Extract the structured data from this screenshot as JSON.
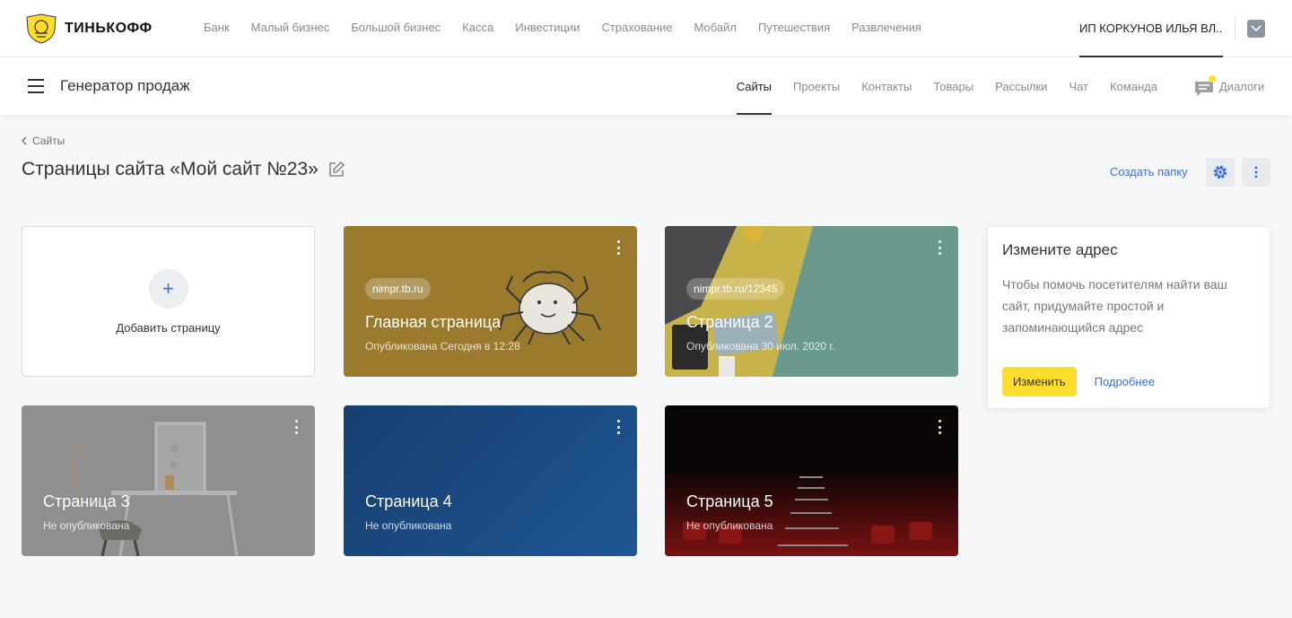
{
  "topbar": {
    "logo_text": "ТИНЬКОФФ",
    "nav": [
      "Банк",
      "Малый бизнес",
      "Большой бизнес",
      "Касса",
      "Инвестиции",
      "Страхование",
      "Мобайл",
      "Путешествия",
      "Развлечения"
    ],
    "account": "ИП КОРКУНОВ ИЛЬЯ ВЛ..."
  },
  "subbar": {
    "title": "Генератор продаж",
    "nav": [
      "Сайты",
      "Проекты",
      "Контакты",
      "Товары",
      "Рассылки",
      "Чат",
      "Команда"
    ],
    "active": "Сайты",
    "dialogs": "Диалоги"
  },
  "page": {
    "breadcrumb": "Сайты",
    "title": "Страницы сайта «Мой сайт №23»",
    "create_folder": "Создать папку"
  },
  "add_card": {
    "label": "Добавить страницу",
    "plus": "+"
  },
  "cards": [
    {
      "domain": "nimpr.tb.ru",
      "name": "Главная страница",
      "status": "Опубликована Сегодня в 12:28",
      "bg": "#9a7a2d"
    },
    {
      "domain": "nimpr.tb.ru/12345",
      "name": "Страница 2",
      "status": "Опубликована 30 июл. 2020 г.",
      "bg": "#6a9a8e"
    },
    {
      "name": "Страница 3",
      "status": "Не опубликована",
      "bg": "#8f8f8f"
    },
    {
      "name": "Страница 4",
      "status": "Не опубликована",
      "bg": "#1d4f86"
    },
    {
      "name": "Страница 5",
      "status": "Не опубликована",
      "bg": "#1a0a0a"
    }
  ],
  "info": {
    "title": "Измените адрес",
    "text": "Чтобы помочь посетителям найти ваш сайт, придумайте простой и запоминающийся адрес",
    "primary": "Изменить",
    "secondary": "Подробнее"
  },
  "colors": {
    "accent": "#ffdd2d",
    "link": "#336fee"
  }
}
